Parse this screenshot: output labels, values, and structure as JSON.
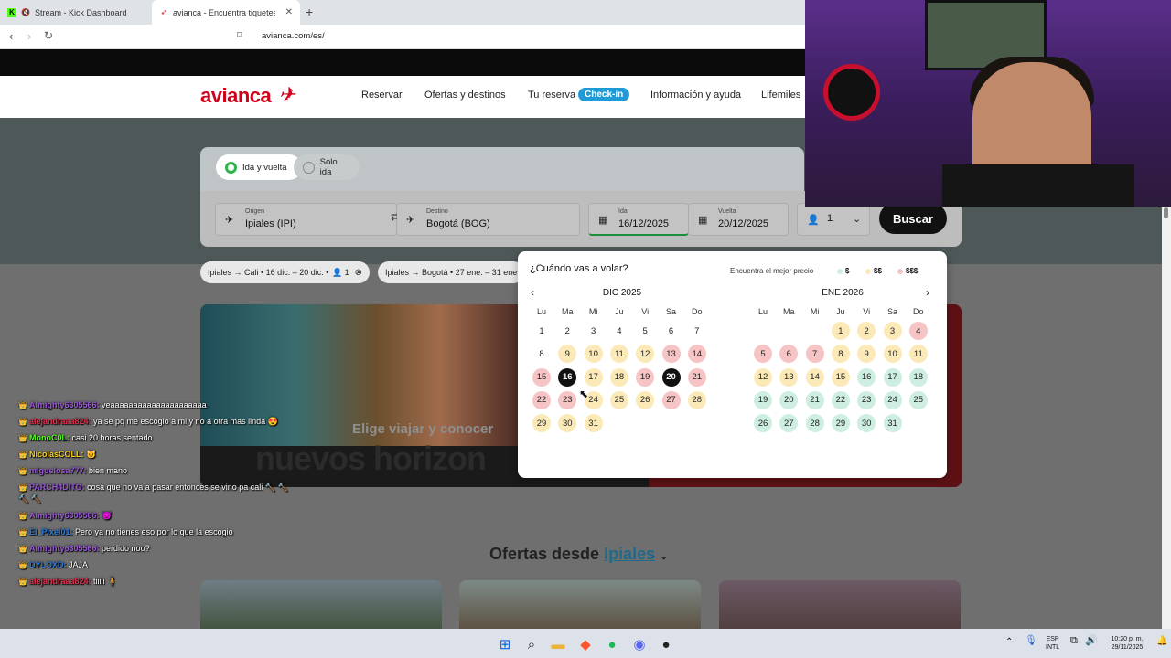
{
  "browser": {
    "tabs": [
      {
        "title": "Stream - Kick Dashboard",
        "icon": "kick-icon"
      },
      {
        "title": "avianca - Encuentra tiquetes y v",
        "icon": "avianca-icon"
      }
    ],
    "url": "avianca.com/es/"
  },
  "site": {
    "logo": "avianca",
    "nav": [
      "Reservar",
      "Ofertas y destinos",
      "Tu reserva",
      "Información y ayuda",
      "Lifemiles"
    ],
    "checkin": "Check-in",
    "trip_types": [
      "Ida y vuelta",
      "Solo ida"
    ],
    "origin_label": "Origen",
    "origin_value": "Ipiales  (IPI)",
    "dest_label": "Destino",
    "dest_value": "Bogotá  (BOG)",
    "ida_label": "Ida",
    "ida_value": "16/12/2025",
    "vuelta_label": "Vuelta",
    "vuelta_value": "20/12/2025",
    "passengers": "1",
    "search_button": "Buscar",
    "recent": [
      "Ipiales → Cali  •  16 dic. – 20 dic.  •",
      "Ipiales → Bogotá  •  27 ene. – 31 ene"
    ],
    "recent_pax": "1",
    "banner_line1": "Elige viajar y conocer",
    "banner_line2": "nuevos horizon",
    "offers_title": "Ofertas desde",
    "offers_city": "Ipiales"
  },
  "calendar": {
    "question": "¿Cuándo vas a volar?",
    "best_price": "Encuentra el mejor precio",
    "legend": [
      {
        "label": "$",
        "color": "#cdeee0"
      },
      {
        "label": "$$",
        "color": "#fbeab8"
      },
      {
        "label": "$$$",
        "color": "#f6c4c4"
      }
    ],
    "weekdays": [
      "Lu",
      "Ma",
      "Mi",
      "Ju",
      "Vi",
      "Sa",
      "Do"
    ],
    "months": [
      {
        "title": "DIC 2025",
        "first_col": 0,
        "days": 31,
        "price": {
          "9": "y",
          "10": "y",
          "11": "y",
          "12": "y",
          "13": "r",
          "14": "r",
          "15": "r",
          "17": "y",
          "18": "y",
          "19": "r",
          "21": "r",
          "22": "r",
          "23": "r",
          "24": "y",
          "25": "y",
          "26": "y",
          "27": "r",
          "28": "y",
          "29": "y",
          "30": "y",
          "31": "y"
        },
        "selected": [
          16,
          20
        ]
      },
      {
        "title": "ENE 2026",
        "first_col": 3,
        "days": 31,
        "price": {
          "1": "y",
          "2": "y",
          "3": "y",
          "4": "r",
          "5": "r",
          "6": "r",
          "7": "r",
          "8": "y",
          "9": "y",
          "10": "y",
          "11": "y",
          "12": "y",
          "13": "y",
          "14": "y",
          "15": "y",
          "16": "g",
          "17": "g",
          "18": "g",
          "19": "g",
          "20": "g",
          "21": "g",
          "22": "g",
          "23": "g",
          "24": "g",
          "25": "g",
          "26": "g",
          "27": "g",
          "28": "g",
          "29": "g",
          "30": "g",
          "31": "g"
        },
        "selected": []
      }
    ]
  },
  "chat": [
    {
      "user": "Almighty6305566:",
      "text": "veaaaaaaaaaaaaaaaaaaaaa",
      "color": "#9b59d6"
    },
    {
      "user": "alejandraaa824:",
      "text": "ya se pq me escogio a mi y no a otra mas linda 😍",
      "color": "#e0304e"
    },
    {
      "user": "MonoC0L:",
      "text": "casi 20 horas sentado",
      "color": "#53fc18"
    },
    {
      "user": "NicolasCOLL:",
      "text": "😺",
      "color": "#f5d020"
    },
    {
      "user": "miguelosa777:",
      "text": "bien mano",
      "color": "#9b59d6"
    },
    {
      "user": "PARCH4DITO:",
      "text": "cosa que no va a pasar entonces se vino pa cali 🔨 🔨 🔨 🔨",
      "color": "#9b59d6"
    },
    {
      "user": "Almighty6305566:",
      "text": "😈",
      "color": "#9b59d6"
    },
    {
      "user": "El_Pixel01:",
      "text": "Pero ya no tienes eso por lo que la escogio",
      "color": "#2b7bd8"
    },
    {
      "user": "Almighty6305566:",
      "text": "perdido noo?",
      "color": "#9b59d6"
    },
    {
      "user": "DYLOXD:",
      "text": "JAJA",
      "color": "#2b7bd8"
    },
    {
      "user": "alejandraaa824:",
      "text": "tiiiii 🧍",
      "color": "#e0304e"
    }
  ],
  "taskbar": {
    "lang": "ESP",
    "kb": "INTL",
    "time": "10:20 p. m.",
    "date": "29/11/2025"
  }
}
